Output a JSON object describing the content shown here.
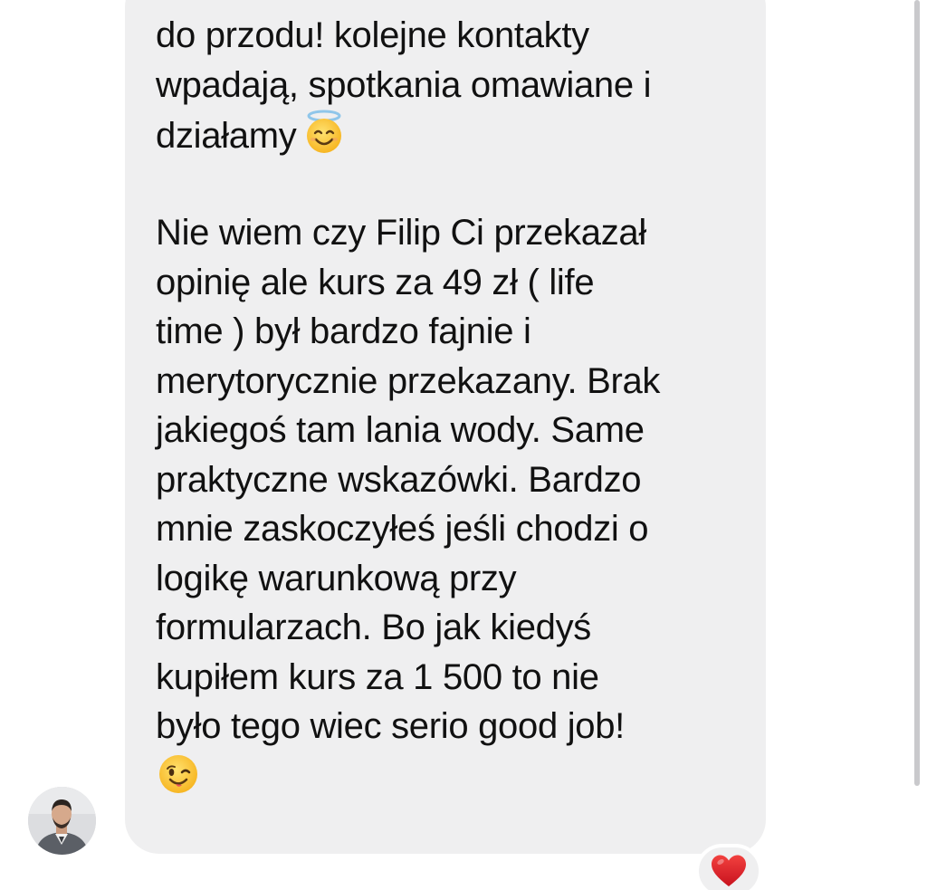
{
  "conversation": {
    "message": {
      "lines": [
        "do przodu! kolejne kontakty",
        "wpadają, spotkania omawiane i",
        "działamy",
        "",
        "Nie wiem czy Filip Ci przekazał",
        "opinię ale kurs za 49 zł ( life",
        "time ) był bardzo fajnie i",
        "merytorycznie przekazany. Brak",
        "jakiegoś tam lania wody. Same",
        "praktyczne wskazówki. Bardzo",
        "mnie zaskoczyłeś jeśli chodzi o",
        "logikę warunkową przy",
        "formularzach. Bo jak kiedyś",
        "kupiłem kurs za 1 500 to nie",
        "było tego wiec serio good job!",
        ""
      ],
      "emojis": {
        "line_3": "smiling-face-with-halo-icon",
        "line_16": "winking-face-icon"
      },
      "bubble_color": "#efeff0",
      "text_color": "#111111"
    },
    "sender": {
      "avatar_icon": "sender-avatar"
    },
    "reaction": {
      "icon": "red-heart-icon",
      "color": "#e0202e"
    }
  }
}
